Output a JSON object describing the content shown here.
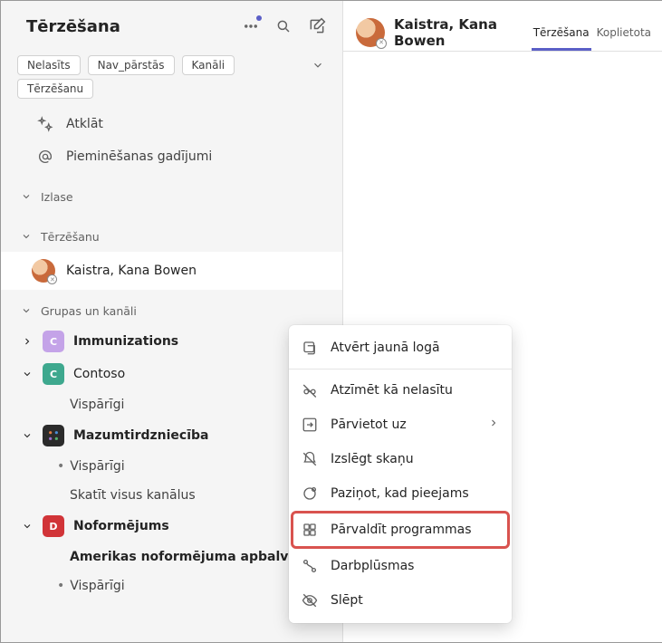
{
  "leftPane": {
    "title": "Tērzēšana",
    "filters": {
      "row1": [
        "Nelasīts",
        "Nav_pārstās",
        "Kanāli"
      ],
      "row2": [
        "Tērzēšanu"
      ]
    },
    "quick": {
      "discover": "Atklāt",
      "mentions": "Pieminēšanas gadījumi"
    },
    "sections": {
      "favorites": "Izlase",
      "chats": "Tērzēšanu",
      "groups": "Grupas un kanāli"
    },
    "activeChat": {
      "name": "Kaistra, Kana  Bowen"
    },
    "teams": [
      {
        "name": "Immunizations",
        "badge": "C",
        "badgeClass": "tb-purple",
        "expanded": false,
        "channels": []
      },
      {
        "name": "Contoso",
        "badge": "C",
        "badgeClass": "tb-teal",
        "expanded": true,
        "channels": [
          {
            "label": "Vispārīgi",
            "dot": false,
            "bold": false
          }
        ]
      },
      {
        "name": "Mazumtirdzniecība",
        "badge": "svg",
        "badgeClass": "tb-dark",
        "expanded": true,
        "channels": [
          {
            "label": "Vispārīgi",
            "dot": true,
            "bold": false
          },
          {
            "label": "Skatīt visus kanālus",
            "dot": false,
            "bold": false
          }
        ]
      },
      {
        "name": "Noformējums",
        "badge": "D",
        "badgeClass": "tb-red",
        "expanded": true,
        "channels": [
          {
            "label": "Amerikas noformējuma apbalvojums",
            "dot": false,
            "bold": true
          },
          {
            "label": "Vispārīgi",
            "dot": true,
            "bold": false
          }
        ]
      }
    ]
  },
  "rightPane": {
    "name": "Kaistra, Kana  Bowen",
    "tabs": [
      {
        "label": "Tērzēšana",
        "active": true
      },
      {
        "label": "Koplietota",
        "active": false
      }
    ]
  },
  "contextMenu": {
    "items": [
      {
        "icon": "popout",
        "label": "Atvērt jaunā logā"
      },
      {
        "sep": true
      },
      {
        "icon": "unread",
        "label": "Atzīmēt kā nelasītu"
      },
      {
        "icon": "move",
        "label": "Pārvietot uz",
        "arrow": true
      },
      {
        "icon": "mute",
        "label": "Izslēgt skaņu"
      },
      {
        "icon": "notify",
        "label": "Paziņot, kad pieejams"
      },
      {
        "icon": "apps",
        "label": "Pārvaldīt programmas",
        "highlight": true
      },
      {
        "icon": "flow",
        "label": "Darbplūsmas"
      },
      {
        "icon": "hide",
        "label": "Slēpt"
      }
    ]
  }
}
